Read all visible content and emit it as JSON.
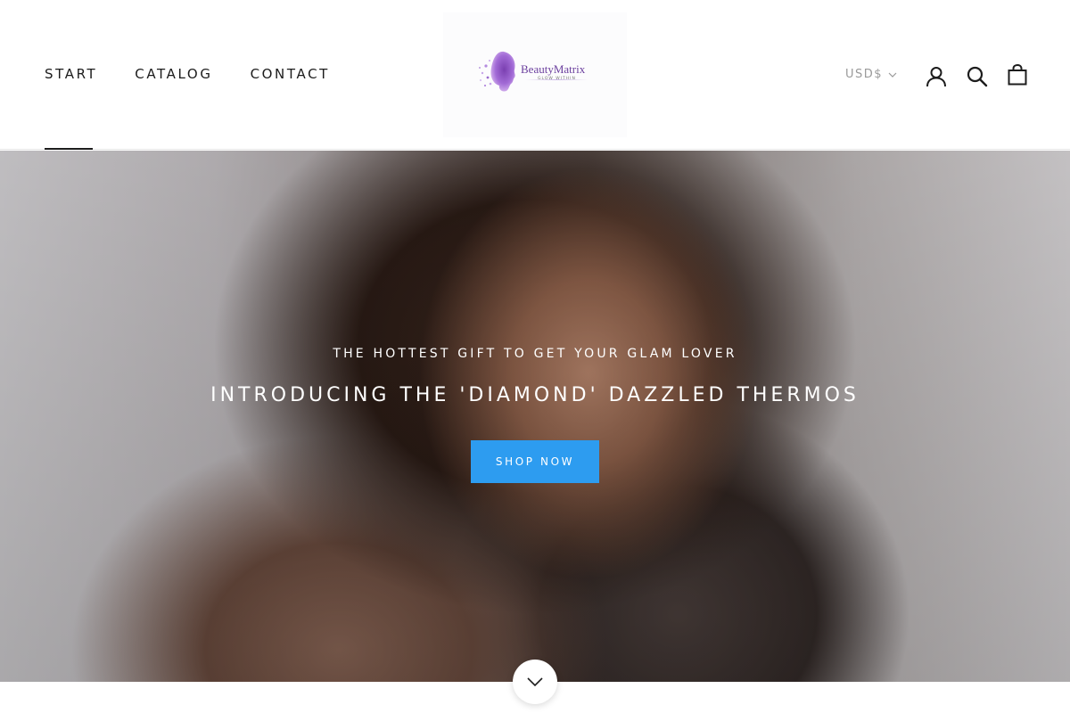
{
  "header": {
    "nav": [
      {
        "label": "START"
      },
      {
        "label": "CATALOG"
      },
      {
        "label": "CONTACT"
      }
    ],
    "logo": {
      "name": "BeautyMatrix",
      "tagline": "GLOW WITHIN"
    },
    "currency": {
      "label": "USD$",
      "icon": "chevron-down-icon"
    },
    "icons": [
      "account-icon",
      "search-icon",
      "cart-bag-icon"
    ]
  },
  "hero": {
    "eyebrow": "THE HOTTEST GIFT TO GET YOUR GLAM LOVER",
    "title": "INTRODUCING THE 'DIAMOND' DAZZLED THERMOS",
    "cta_label": "SHOP NOW"
  },
  "scroll": {
    "icon": "chevron-down-icon"
  },
  "colors": {
    "accent": "#2d9cf0",
    "text": "#1c1c1c",
    "muted": "#9a9a9a",
    "brand": "#6b3f9e"
  }
}
